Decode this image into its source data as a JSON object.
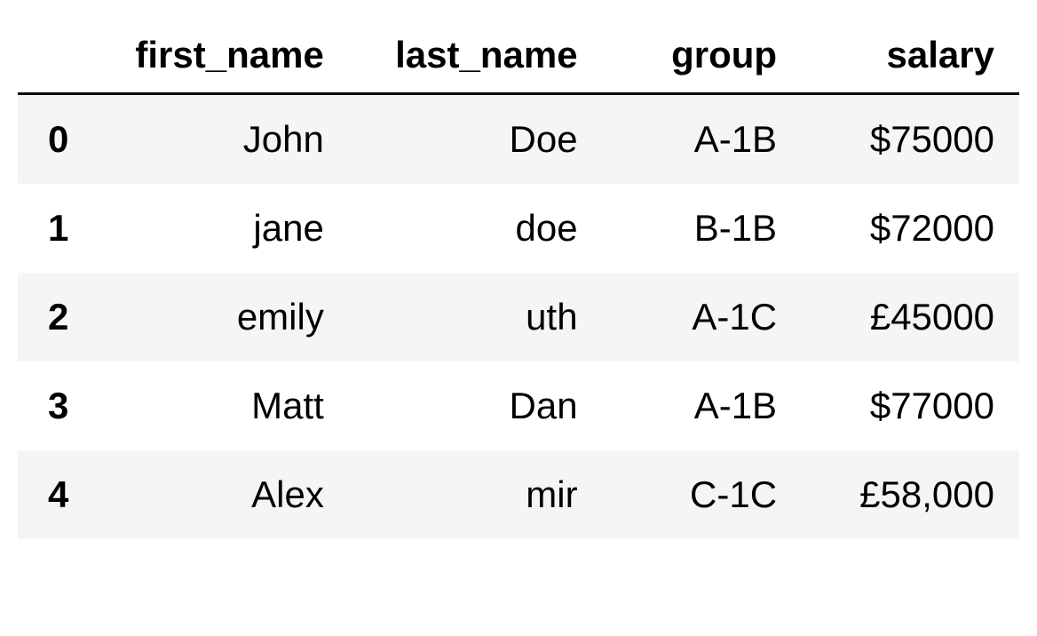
{
  "table": {
    "columns": [
      "first_name",
      "last_name",
      "group",
      "salary"
    ],
    "rows": [
      {
        "index": "0",
        "first_name": "John",
        "last_name": "Doe",
        "group": "A-1B",
        "salary": "$75000"
      },
      {
        "index": "1",
        "first_name": "jane",
        "last_name": "doe",
        "group": "B-1B",
        "salary": "$72000"
      },
      {
        "index": "2",
        "first_name": "emily",
        "last_name": "uth",
        "group": "A-1C",
        "salary": "£45000"
      },
      {
        "index": "3",
        "first_name": "Matt",
        "last_name": "Dan",
        "group": "A-1B",
        "salary": "$77000"
      },
      {
        "index": "4",
        "first_name": "Alex",
        "last_name": "mir",
        "group": "C-1C",
        "salary": "£58,000"
      }
    ]
  }
}
